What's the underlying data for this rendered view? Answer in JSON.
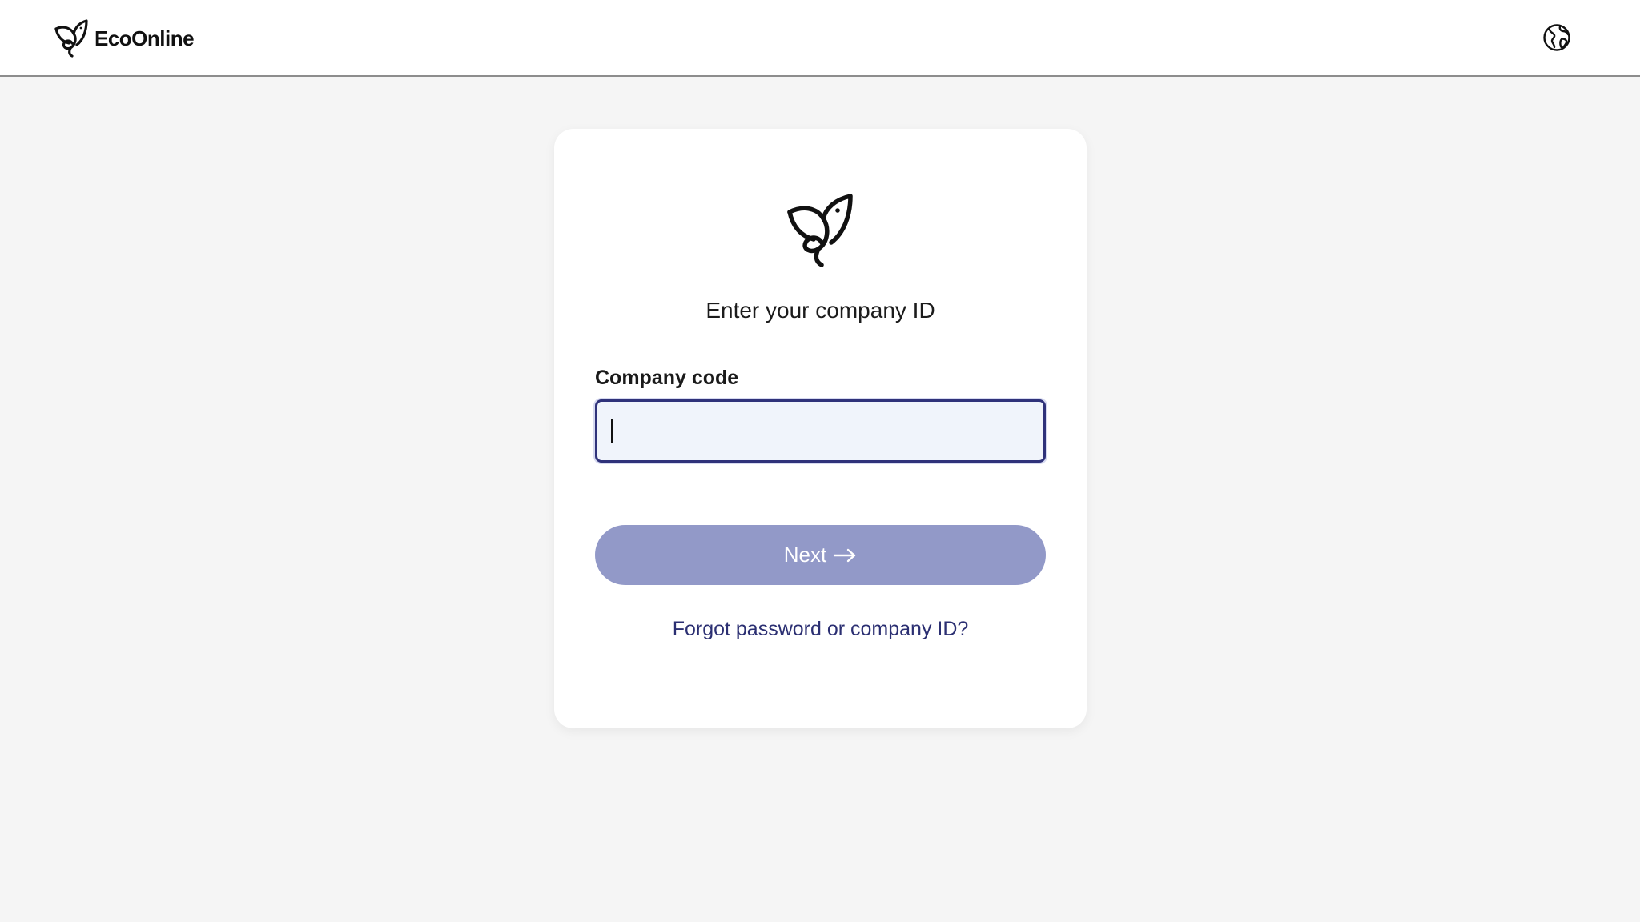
{
  "header": {
    "brand_name": "EcoOnline",
    "brand_icon": "bird-logo-icon",
    "language_icon": "globe-icon"
  },
  "login_card": {
    "logo_icon": "bird-logo-icon",
    "title": "Enter your company ID",
    "company_code": {
      "label": "Company code",
      "value": "",
      "focused": true
    },
    "next_button": {
      "label": "Next",
      "icon": "arrow-right-icon",
      "state": "disabled"
    },
    "forgot_link": "Forgot password or company ID?"
  },
  "colors": {
    "page_background": "#f5f5f5",
    "card_background": "#ffffff",
    "input_border": "#2f327a",
    "input_background": "#f0f4fb",
    "button_background": "#9299c8",
    "link": "#2b2f72"
  }
}
